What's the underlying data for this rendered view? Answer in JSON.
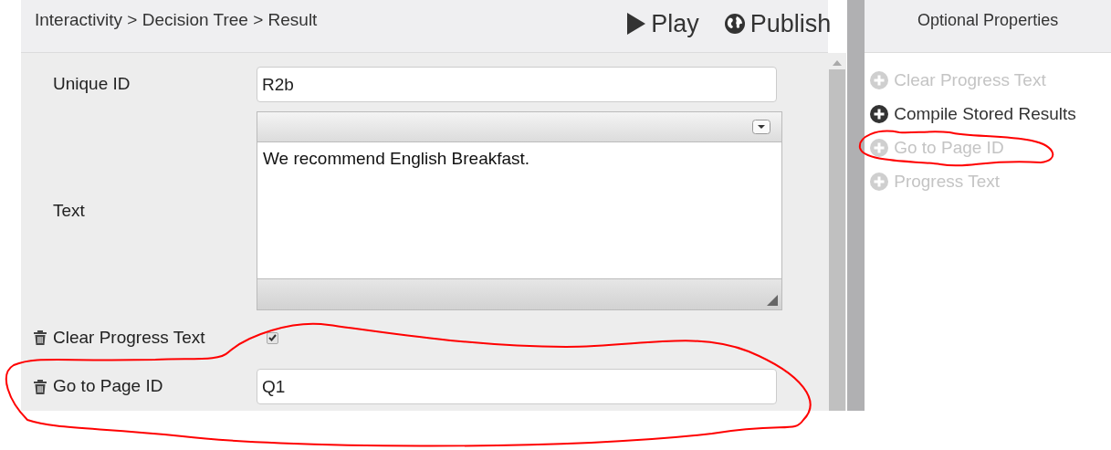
{
  "breadcrumb": "Interactivity > Decision Tree > Result",
  "actions": [
    {
      "kind": "play",
      "label": "Play"
    },
    {
      "kind": "publish",
      "label": "Publish"
    }
  ],
  "fields": [
    {
      "kind": "text",
      "label": "Unique ID",
      "value": "R2b",
      "removable": false
    },
    {
      "kind": "richtext",
      "label": "Text",
      "value": "We recommend English Breakfast.",
      "removable": false
    },
    {
      "kind": "checkbox",
      "label": "Clear Progress Text",
      "checked": true,
      "removable": true
    },
    {
      "kind": "text",
      "label": "Go to Page ID",
      "value": "Q1",
      "removable": true
    }
  ],
  "optional_properties": {
    "title": "Optional Properties",
    "items": [
      {
        "label": "Clear Progress Text",
        "disabled": true
      },
      {
        "label": "Compile Stored Results",
        "disabled": false
      },
      {
        "label": "Go to Page ID",
        "disabled": true
      },
      {
        "label": "Progress Text",
        "disabled": true
      }
    ]
  }
}
